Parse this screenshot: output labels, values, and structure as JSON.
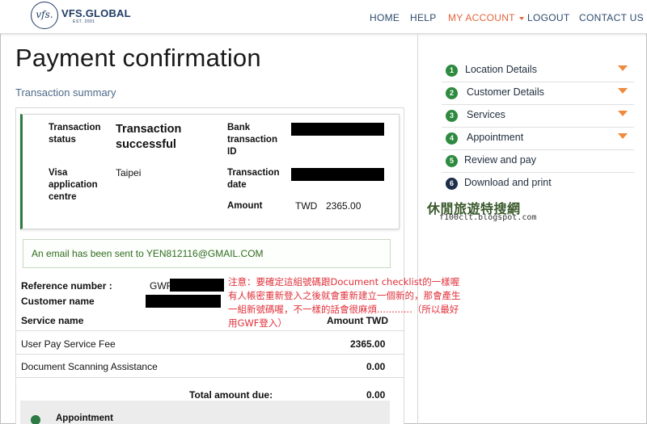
{
  "header": {
    "logo_mark": "vfs.",
    "logo_text": "VFS.GLOBAL",
    "logo_sub": "EST. 2001",
    "nav": {
      "home": "HOME",
      "help": "HELP",
      "my_account": "MY ACCOUNT",
      "logout": "LOGOUT",
      "contact": "CONTACT US"
    },
    "accent_color": "#e3643a",
    "brand_color": "#1f3b64"
  },
  "page": {
    "title": "Payment confirmation",
    "subtitle": "Transaction summary"
  },
  "summary": {
    "status_label": "Transaction status",
    "status_value": "Transaction successful",
    "bank_id_label": "Bank transaction ID",
    "centre_label": "Visa application centre",
    "centre_value": "Taipei",
    "date_label": "Transaction date",
    "amount_label": "Amount",
    "amount_currency": "TWD",
    "amount_value": "2365.00"
  },
  "email_notice": "An email has been sent to YEN812116@GMAIL.COM",
  "reference": {
    "ref_label": "Reference number :",
    "ref_prefix": "GWF",
    "customer_label": "Customer name"
  },
  "services": {
    "header_service": "Service name",
    "header_amount": "Amount TWD",
    "rows": [
      {
        "name": "User Pay Service Fee",
        "amount": "2365.00"
      },
      {
        "name": "Document Scanning Assistance",
        "amount": "0.00"
      }
    ],
    "total_label": "Total amount due:",
    "total_value": "0.00"
  },
  "appointment_label": "Appointment",
  "steps": [
    {
      "num": "1",
      "label": "Location Details"
    },
    {
      "num": "2",
      "label": "Customer Details"
    },
    {
      "num": "3",
      "label": "Services"
    },
    {
      "num": "4",
      "label": "Appointment"
    },
    {
      "num": "5",
      "label": "Review and pay"
    },
    {
      "num": "6",
      "label": "Download and print"
    }
  ],
  "watermark": {
    "title": "休閒旅遊特搜網",
    "url": "f100clt.blogspot.com"
  },
  "annotation": "注意：要確定這組號碼跟Document checklist的一樣喔 有人帳密重新登入之後就會重新建立一個新的，那會產生一組新號碼喔，不一樣的話會很麻煩............（所以最好用GWF登入）"
}
